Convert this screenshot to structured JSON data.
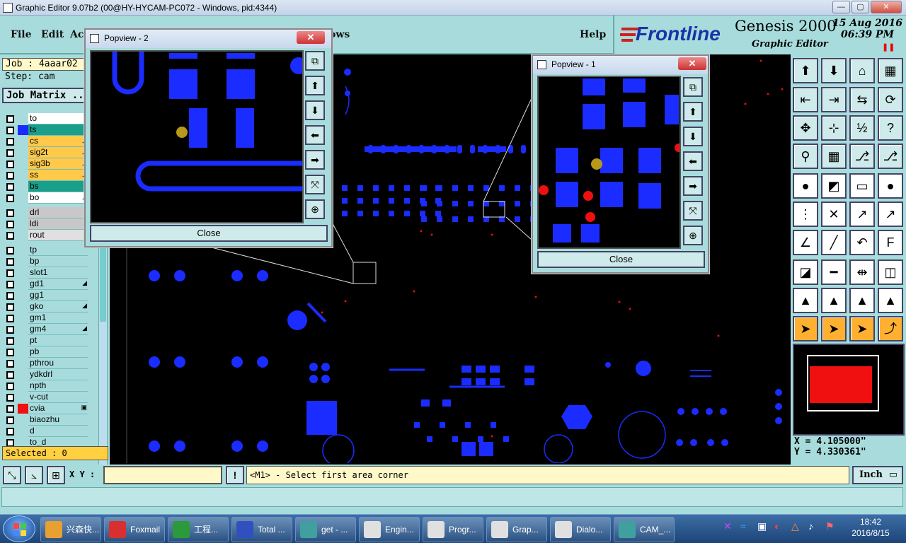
{
  "window": {
    "title": "Graphic Editor 9.07b2 (00@HY-HYCAM-PC072 - Windows, pid:4344)",
    "min": "—",
    "max": "▢",
    "close": "✕"
  },
  "menu": {
    "file": "File",
    "edit": "Edit",
    "action": "Ac",
    "rows": "ows",
    "help": "Help"
  },
  "brand": {
    "logo": "Frontline",
    "product": "Genesis 2000",
    "subtitle": "Graphic Editor",
    "date": "15 Aug 2016",
    "time": "06:39 PM",
    "pause": "❚❚"
  },
  "job": {
    "job_label": "Job : 4aaar02",
    "step_label": "Step: cam",
    "matrix": "Job Matrix .."
  },
  "layers": [
    {
      "name": "to",
      "color": "#ffffff",
      "mark": ""
    },
    {
      "name": "ts",
      "color": "#1aa08a",
      "mark": ""
    },
    {
      "name": "cs",
      "color": "#ffc94a",
      "mark": "◢"
    },
    {
      "name": "sig2t",
      "color": "#ffc94a",
      "mark": "◢"
    },
    {
      "name": "sig3b",
      "color": "#ffc94a",
      "mark": "◢"
    },
    {
      "name": "ss",
      "color": "#ffc94a",
      "mark": "◢"
    },
    {
      "name": "bs",
      "color": "#1aa08a",
      "mark": ""
    },
    {
      "name": "bo",
      "color": "#ffffff",
      "mark": "◢"
    },
    {
      "name": "drl",
      "color": "#c8c8c8",
      "mark": ""
    },
    {
      "name": "ldi",
      "color": "#c8c8c8",
      "mark": ""
    },
    {
      "name": "rout",
      "color": "#e0e0e0",
      "mark": ""
    },
    {
      "name": "tp",
      "color": "#a8dcdc",
      "mark": ""
    },
    {
      "name": "bp",
      "color": "#a8dcdc",
      "mark": ""
    },
    {
      "name": "slot1",
      "color": "#a8dcdc",
      "mark": ""
    },
    {
      "name": "gd1",
      "color": "#a8dcdc",
      "mark": "◢"
    },
    {
      "name": "gg1",
      "color": "#a8dcdc",
      "mark": ""
    },
    {
      "name": "gko",
      "color": "#a8dcdc",
      "mark": "◢"
    },
    {
      "name": "gm1",
      "color": "#a8dcdc",
      "mark": ""
    },
    {
      "name": "gm4",
      "color": "#a8dcdc",
      "mark": "◢"
    },
    {
      "name": "pt",
      "color": "#a8dcdc",
      "mark": ""
    },
    {
      "name": "pb",
      "color": "#a8dcdc",
      "mark": ""
    },
    {
      "name": "pthrou",
      "color": "#a8dcdc",
      "mark": ""
    },
    {
      "name": "ydkdrl",
      "color": "#a8dcdc",
      "mark": ""
    },
    {
      "name": "npth",
      "color": "#a8dcdc",
      "mark": ""
    },
    {
      "name": "v-cut",
      "color": "#a8dcdc",
      "mark": ""
    },
    {
      "name": "cvia",
      "color": "#a8dcdc",
      "mark": "▣"
    },
    {
      "name": "biaozhu",
      "color": "#a8dcdc",
      "mark": ""
    },
    {
      "name": "d",
      "color": "#a8dcdc",
      "mark": ""
    },
    {
      "name": "to_d",
      "color": "#a8dcdc",
      "mark": ""
    }
  ],
  "selected": "Selected : 0",
  "coords": {
    "x": "X = 4.105000\"",
    "y": "Y = 4.330361\""
  },
  "units": "Inch",
  "xy_label": "X Y :",
  "prompt": "<M1> - Select first area corner",
  "popview2": {
    "title": "Popview - 2",
    "close": "Close"
  },
  "popview1": {
    "title": "Popview - 1",
    "close": "Close"
  },
  "taskbar": [
    {
      "label": "兴森快...",
      "color": "#e8a030"
    },
    {
      "label": "Foxmail",
      "color": "#d83030"
    },
    {
      "label": "工程...",
      "color": "#2a9a3a"
    },
    {
      "label": "Total ...",
      "color": "#3050c0"
    },
    {
      "label": "get - ...",
      "color": "#40a0a0"
    },
    {
      "label": "Engin...",
      "color": "#e0e0e0"
    },
    {
      "label": "Progr...",
      "color": "#e0e0e0"
    },
    {
      "label": "Grap...",
      "color": "#e0e0e0"
    },
    {
      "label": "Dialo...",
      "color": "#e0e0e0"
    },
    {
      "label": "CAM_...",
      "color": "#40a0a0"
    }
  ],
  "clock": {
    "time": "18:42",
    "date": "2016/8/15"
  }
}
